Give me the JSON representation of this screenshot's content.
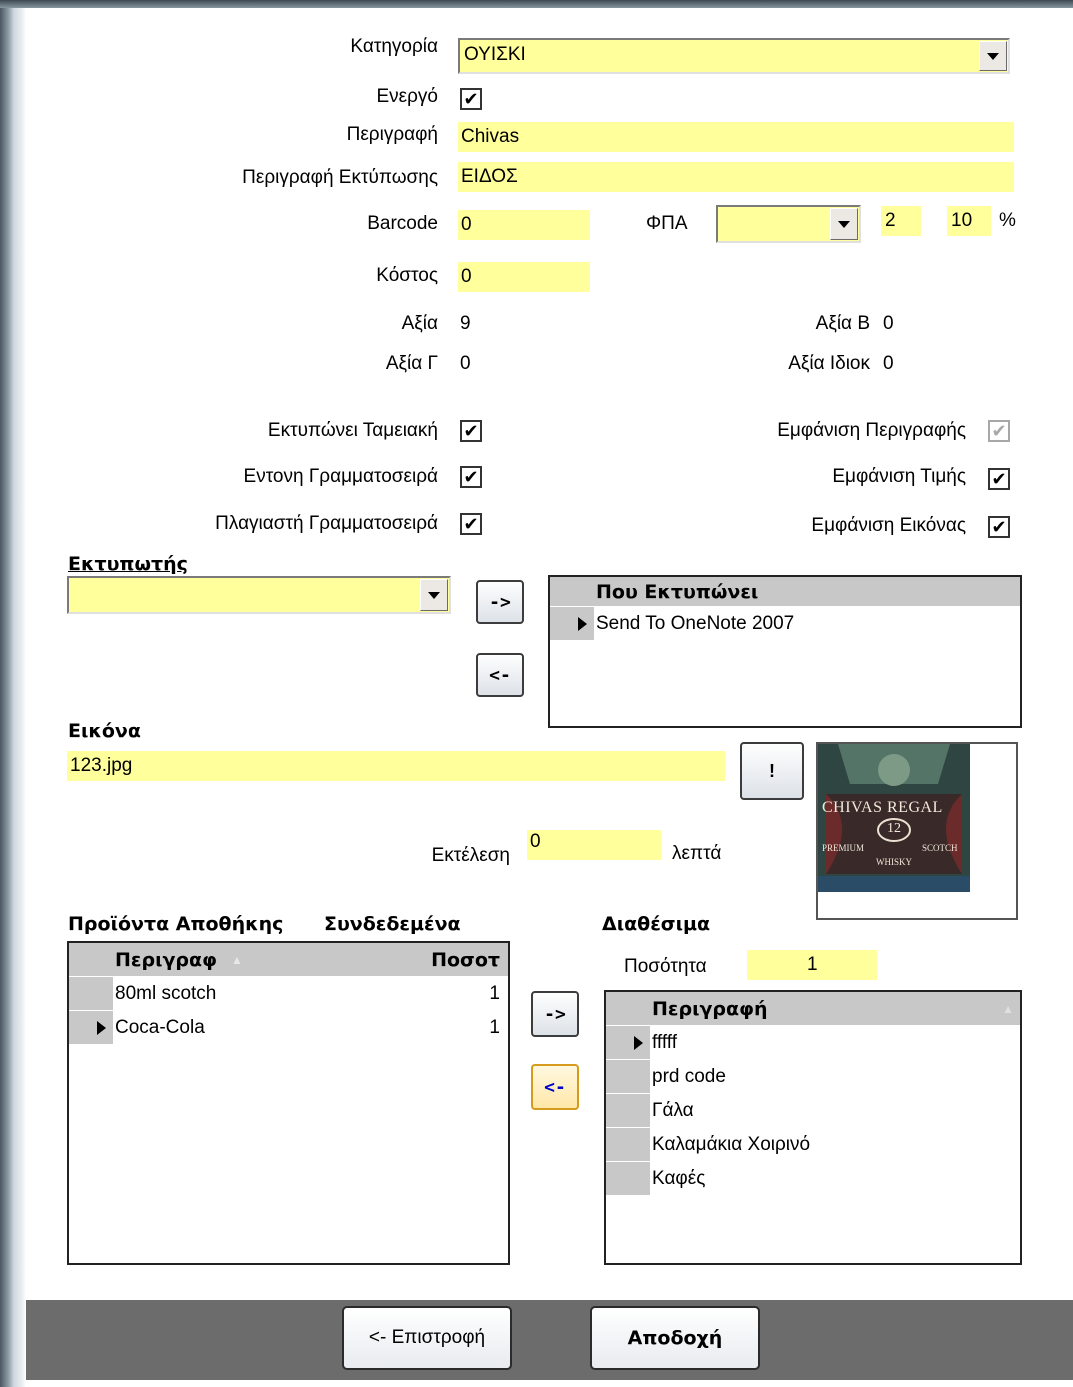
{
  "category": {
    "label": "Κατηγορία",
    "value": "ΟΥΙΣΚΙ"
  },
  "active": {
    "label": "Ενεργό",
    "checked": true
  },
  "description": {
    "label": "Περιγραφή",
    "value": "Chivas"
  },
  "print_description": {
    "label": "Περιγραφή Εκτύπωσης",
    "value": "ΕΙΔΟΣ"
  },
  "barcode": {
    "label": "Barcode",
    "value": "0"
  },
  "vat": {
    "label": "ΦΠΑ",
    "selected": "",
    "code": "2",
    "percent": "10",
    "percent_sign": "%"
  },
  "cost": {
    "label": "Κόστος",
    "value": "0"
  },
  "prices": {
    "a_label": "Αξία",
    "a_value": "9",
    "b_label": "Αξία Β",
    "b_value": "0",
    "c_label": "Αξία Γ",
    "c_value": "0",
    "special_label": "Αξία Ιδιοκ",
    "special_value": "0"
  },
  "options": {
    "print_receipt": {
      "label": "Εκτυπώνει Ταμειακή",
      "checked": true
    },
    "bold_font": {
      "label": "Εντονη Γραμματοσειρά",
      "checked": true
    },
    "italic_font": {
      "label": "Πλαγιαστή Γραμματοσειρά",
      "checked": true
    },
    "show_description": {
      "label": "Εμφάνιση Περιγραφής",
      "checked": true,
      "disabled": true
    },
    "show_price": {
      "label": "Εμφάνιση Τιμής",
      "checked": true
    },
    "show_image": {
      "label": "Εμφάνιση Εικόνας",
      "checked": true
    }
  },
  "printer": {
    "heading": "Εκτυπωτής",
    "selected": "",
    "add_label": "->",
    "remove_label": "<-",
    "grid_header": "Που Εκτυπώνει",
    "rows": [
      "Send To OneNote 2007"
    ]
  },
  "image": {
    "heading": "Εικόνα",
    "file": "123.jpg",
    "browse_label": "!",
    "execute_label": "Εκτέλεση",
    "execute_value": "0",
    "minutes_label": "λεπτά",
    "photo_text": {
      "brand": "CHIVAS REGAL",
      "age": "12",
      "line1": "PREMIUM",
      "line2": "SCOTCH",
      "line3": "WHISKY"
    }
  },
  "warehouse": {
    "heading": "Προϊόντα Αποθήκης",
    "linked_heading": "Συνδεδεμένα",
    "columns": [
      "Περιγραφ",
      "Ποσοτ"
    ],
    "rows": [
      {
        "name": "80ml scotch",
        "qty": "1"
      },
      {
        "name": "Coca-Cola",
        "qty": "1"
      }
    ],
    "add_label": "->",
    "remove_label": "<-"
  },
  "available": {
    "heading": "Διαθέσιμα",
    "quantity_label": "Ποσότητα",
    "quantity_value": "1",
    "column": "Περιγραφή",
    "rows": [
      "fffff",
      "prd code",
      "Γάλα",
      "Καλαμάκια Χοιρινό",
      "Καφές"
    ]
  },
  "footer": {
    "back_label": "<- Επιστροφή",
    "accept_label": "Αποδοχή"
  },
  "colors": {
    "field_bg": "#ffff9c",
    "grid_header": "#c8c8c8",
    "footer_bg": "#6c6c6c"
  }
}
